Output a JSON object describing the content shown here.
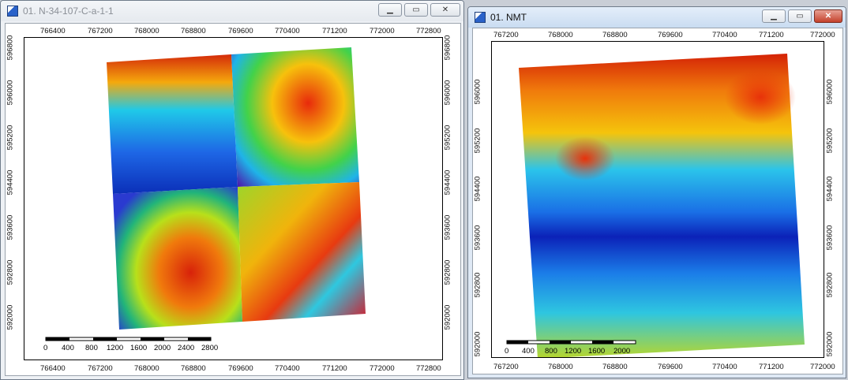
{
  "windows": [
    {
      "title": "01. N-34-107-C-a-1-1",
      "state": "inactive",
      "x_ticks": [
        "766400",
        "767200",
        "768000",
        "768800",
        "769600",
        "770400",
        "771200",
        "772000",
        "772800"
      ],
      "y_ticks": [
        "596800",
        "596000",
        "595200",
        "594400",
        "593600",
        "592800",
        "592000"
      ],
      "scale_labels": [
        "0",
        "400",
        "800",
        "1200",
        "1600",
        "2000",
        "2400",
        "2800"
      ],
      "controls": {
        "minimize": "▁",
        "maximize": "▭",
        "close": "✕"
      }
    },
    {
      "title": "01. NMT",
      "state": "active",
      "x_ticks": [
        "767200",
        "768000",
        "768800",
        "769600",
        "770400",
        "771200",
        "772000"
      ],
      "y_ticks": [
        "596000",
        "595200",
        "594400",
        "593600",
        "592800",
        "592000"
      ],
      "scale_labels": [
        "0",
        "400",
        "800",
        "1200",
        "1600",
        "2000"
      ],
      "controls": {
        "minimize": "▁",
        "maximize": "▭",
        "close": "✕"
      }
    }
  ]
}
